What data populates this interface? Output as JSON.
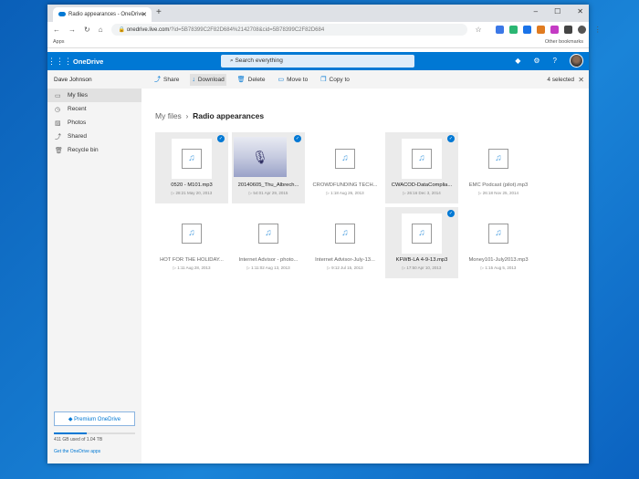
{
  "browser": {
    "tab_title": "Radio appearances - OneDrive",
    "url_host": "onedrive.live.com",
    "url_rest": "/?id=5B78399C2F82D684%2142708&cid=5B78399C2F82D684",
    "bookmarks_apps": "Apps",
    "other_bookmarks": "Other bookmarks"
  },
  "header": {
    "app": "OneDrive",
    "search_placeholder": "Search everything"
  },
  "commands": {
    "share": "Share",
    "download": "Download",
    "delete": "Delete",
    "move": "Move to",
    "copy": "Copy to",
    "selected": "4 selected"
  },
  "sidebar": {
    "user": "Dave Johnson",
    "items": [
      {
        "label": "My files",
        "icon": "folder"
      },
      {
        "label": "Recent",
        "icon": "clock"
      },
      {
        "label": "Photos",
        "icon": "image"
      },
      {
        "label": "Shared",
        "icon": "share"
      },
      {
        "label": "Recycle bin",
        "icon": "trash"
      }
    ],
    "premium": "Premium OneDrive",
    "quota": "411 GB used of 1.04 TB",
    "quota_fraction": 0.4,
    "get_apps": "Get the OneDrive apps"
  },
  "breadcrumb": {
    "root": "My files",
    "current": "Radio appearances"
  },
  "files": [
    {
      "name": "0520 - M101.mp3",
      "meta": "28:21  May 20, 2013",
      "selected": true
    },
    {
      "name": "20140605_Thu_Albrech...",
      "meta": "54:01  Apr 29, 2015",
      "selected": true,
      "thumbnail": true
    },
    {
      "name": "CROWDFUNDING TECH...",
      "meta": "1:18  Aug 26, 2013",
      "selected": false
    },
    {
      "name": "CWACOD-DataComplia...",
      "meta": "26:16  Dec 3, 2014",
      "selected": true
    },
    {
      "name": "EMC Podcast (pilot).mp3",
      "meta": "26:18  Nov 25, 2014",
      "selected": false
    },
    {
      "name": "HOT FOR THE HOLIDAY...",
      "meta": "1:11  Aug 28, 2013",
      "selected": false
    },
    {
      "name": "Internet Advisor - photo...",
      "meta": "1:11:02  Aug 13, 2013",
      "selected": false
    },
    {
      "name": "Internet Advisor-July-13...",
      "meta": "9:12  Jul 15, 2013",
      "selected": false
    },
    {
      "name": "KFWB-LA 4-9-13.mp3",
      "meta": "17:50  Apr 10, 2013",
      "selected": true
    },
    {
      "name": "Money101-July2013.mp3",
      "meta": "1:15  Aug 5, 2013",
      "selected": false
    }
  ]
}
